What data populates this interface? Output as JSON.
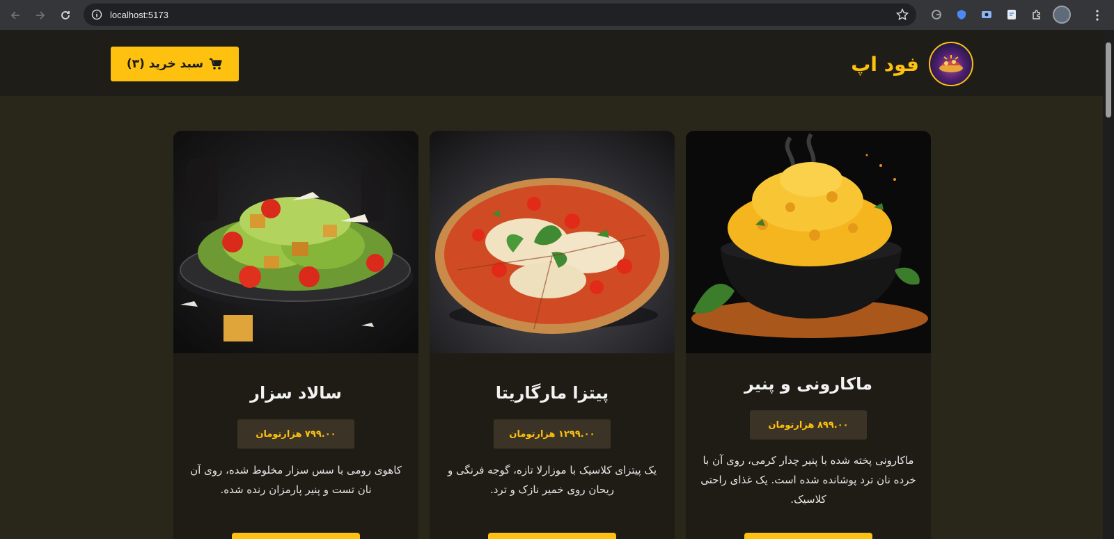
{
  "browser": {
    "url": "localhost:5173"
  },
  "header": {
    "brand_name": "فود اپ",
    "cart_label": "سبد خرید (۳)"
  },
  "menu": [
    {
      "title": "سالاد سزار",
      "price": "۷۹۹.۰۰ هزارتومان",
      "description": "کاهوی رومی با سس سزار مخلوط شده، روی آن نان تست و پنیر پارمزان رنده شده."
    },
    {
      "title": "پیتزا مارگاریتا",
      "price": "۱۲۹۹.۰۰ هزارتومان",
      "description": "یک پیتزای کلاسیک با موزارلا تازه، گوجه فرنگی و ریحان روی خمیر نازک و ترد."
    },
    {
      "title": "ماکارونی و پنیر",
      "price": "۸۹۹.۰۰ هزارتومان",
      "description": "ماکارونی پخته شده با پنیر چدار کرمی، روی آن با خرده نان ترد پوشانده شده است. یک غذای راحتی کلاسیک."
    }
  ],
  "colors": {
    "accent": "#fec10f",
    "page_bg": "#29261a",
    "card_bg": "#1f1c16"
  }
}
